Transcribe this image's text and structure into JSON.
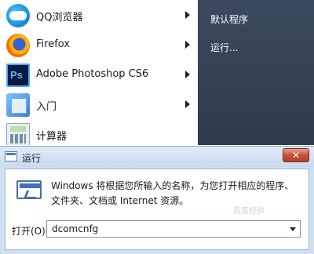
{
  "start_menu": {
    "items": [
      {
        "label": "QQ浏览器",
        "icon": "qq-browser-icon"
      },
      {
        "label": "Firefox",
        "icon": "firefox-icon"
      },
      {
        "label": "Adobe Photoshop CS6",
        "icon": "photoshop-icon"
      },
      {
        "label": "入门",
        "icon": "getting-started-icon"
      },
      {
        "label": "计算器",
        "icon": "calculator-icon"
      }
    ],
    "right": {
      "default_programs": "默认程序",
      "run": "运行..."
    },
    "colors": {
      "right_pane": "#2e3b4a"
    }
  },
  "run_dialog": {
    "title": "运行",
    "close_symbol": "✕",
    "description": "Windows 将根据您所输入的名称，为您打开相应的程序、文件夹、文档或 Internet 资源。",
    "open_label": "打开(O):",
    "input_value": "dcomcnfg",
    "watermark": "百度经验",
    "colors": {
      "close_button": "#c7503a",
      "frame": "#cfe0f1"
    }
  }
}
